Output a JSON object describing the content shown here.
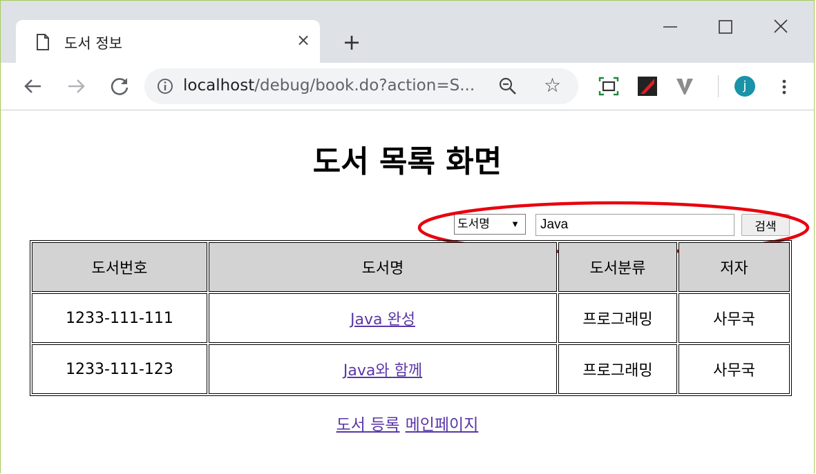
{
  "browser": {
    "tab_title": "도서 정보",
    "new_tab_label": "+",
    "tab_close_label": "×",
    "url_host": "localhost",
    "url_path": "/debug/book.do?action=S...",
    "avatar_letter": "j"
  },
  "page": {
    "title": "도서 목록 화면"
  },
  "search": {
    "field_option": "도서명",
    "query": "Java",
    "button_label": "검색"
  },
  "table": {
    "headers": [
      "도서번호",
      "도서명",
      "도서분류",
      "저자"
    ],
    "rows": [
      {
        "id": "1233-111-111",
        "name": "Java 완성",
        "category": "프로그래밍",
        "author": "사무국"
      },
      {
        "id": "1233-111-123",
        "name": "Java와 함께",
        "category": "프로그래밍",
        "author": "사무국"
      }
    ]
  },
  "footer": {
    "register_label": "도서 등록",
    "main_label": "메인페이지"
  },
  "colors": {
    "annotation": "#e8000d",
    "link_visited": "#5a36a8",
    "header_bg": "#d3d3d3"
  },
  "icons": {
    "tab": "page-icon",
    "back": "back-arrow-icon",
    "forward": "forward-arrow-icon",
    "reload": "reload-icon",
    "info": "info-icon",
    "zoom": "zoom-out-icon",
    "bookmark": "star-icon",
    "menu": "kebab-menu-icon"
  }
}
